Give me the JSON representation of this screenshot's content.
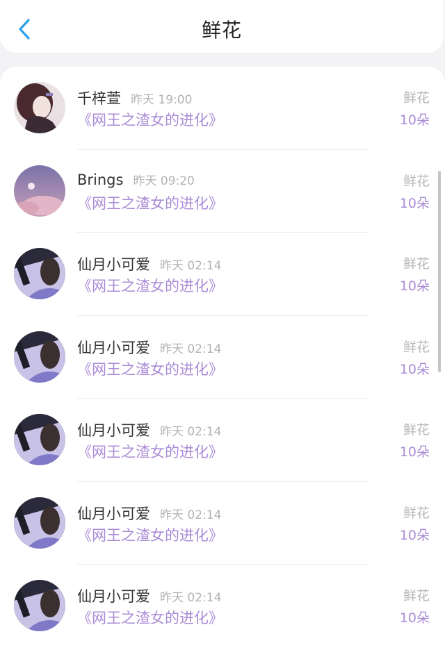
{
  "header": {
    "title": "鲜花"
  },
  "list": [
    {
      "name": "千梓萱",
      "time": "昨天 19:00",
      "book": "《网王之渣女的进化》",
      "gift": "鲜花",
      "count": "10朵"
    },
    {
      "name": "Brings",
      "time": "昨天 09:20",
      "book": "《网王之渣女的进化》",
      "gift": "鲜花",
      "count": "10朵"
    },
    {
      "name": "仙月小可爱",
      "time": "昨天 02:14",
      "book": "《网王之渣女的进化》",
      "gift": "鲜花",
      "count": "10朵"
    },
    {
      "name": "仙月小可爱",
      "time": "昨天 02:14",
      "book": "《网王之渣女的进化》",
      "gift": "鲜花",
      "count": "10朵"
    },
    {
      "name": "仙月小可爱",
      "time": "昨天 02:14",
      "book": "《网王之渣女的进化》",
      "gift": "鲜花",
      "count": "10朵"
    },
    {
      "name": "仙月小可爱",
      "time": "昨天 02:14",
      "book": "《网王之渣女的进化》",
      "gift": "鲜花",
      "count": "10朵"
    },
    {
      "name": "仙月小可爱",
      "time": "昨天 02:14",
      "book": "《网王之渣女的进化》",
      "gift": "鲜花",
      "count": "10朵"
    }
  ],
  "icons": {
    "back": "chevron-left-icon"
  },
  "colors": {
    "accent": "#a98bd6",
    "back_icon": "#2a9fe8"
  }
}
